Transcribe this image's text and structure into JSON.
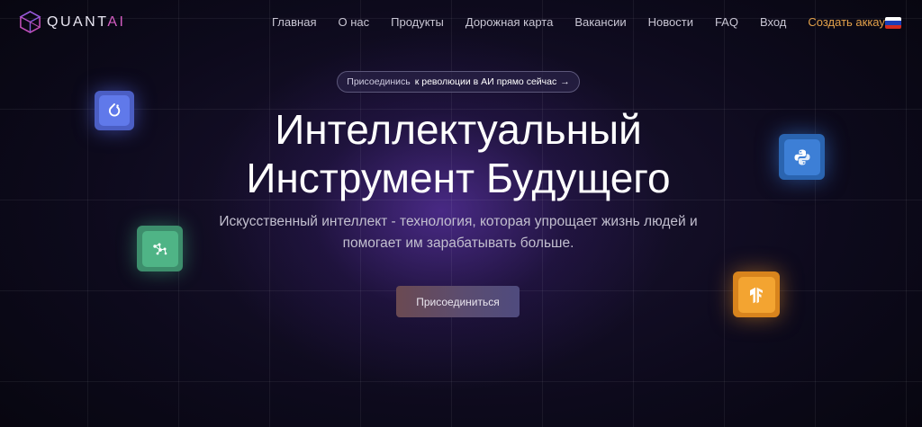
{
  "brand": {
    "name_prefix": "QUANT",
    "name_suffix": "AI"
  },
  "nav": {
    "items": [
      "Главная",
      "О нас",
      "Продукты",
      "Дорожная карта",
      "Вакансии",
      "Новости",
      "FAQ",
      "Вход"
    ],
    "signup": "Создать аккаунт",
    "language_flag": "russian-flag-icon"
  },
  "hero": {
    "pill_prefix": "Присоединись",
    "pill_text": "к революции в АИ прямо сейчас",
    "pill_arrow": "→",
    "title_line1": "Интеллектуальный",
    "title_line2": "Инструмент Будущего",
    "subtitle_line1": "Искусственный интеллект - технология, которая упрощает жизнь людей и",
    "subtitle_line2": "помогает им зарабатывать больше.",
    "cta": "Присоединиться"
  },
  "floating_icons": [
    "pytorch-icon",
    "network-graph-icon",
    "python-icon",
    "tensorflow-icon"
  ],
  "colors": {
    "accent_orange": "#e3a14a",
    "logo_magenta": "#d25cc0",
    "flag": [
      "#ffffff",
      "#1c3fb8",
      "#d52b1e"
    ]
  }
}
